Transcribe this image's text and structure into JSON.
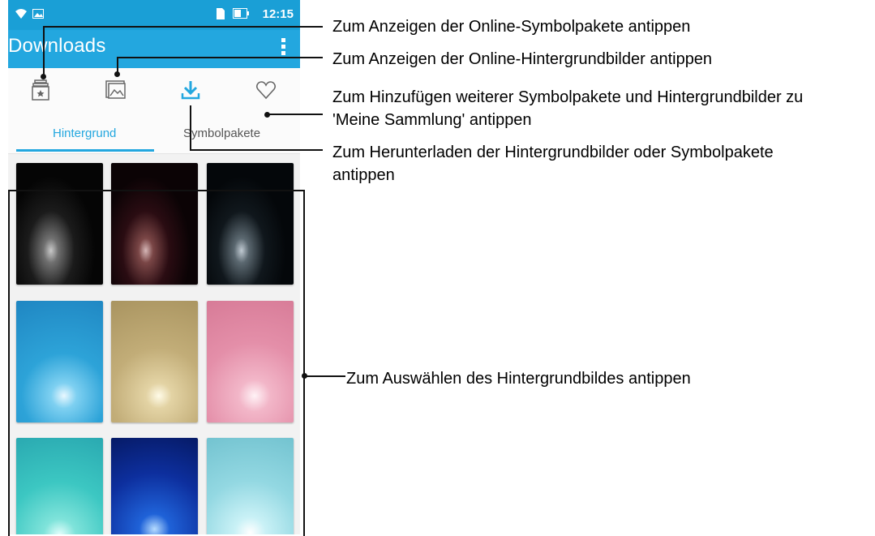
{
  "status_bar": {
    "time": "12:15"
  },
  "app_bar": {
    "title": "Downloads"
  },
  "tabs": [
    {
      "label": "Hintergrund"
    },
    {
      "label": "Symbolpakete"
    }
  ],
  "colors": {
    "accent": "#23a7df",
    "status_bar": "#1a9fd6"
  },
  "icons": [
    "symbol-pack-icon",
    "wallpaper-icon",
    "download-icon",
    "heart-icon",
    "more-vert-icon"
  ],
  "callouts": {
    "online_icon_packs": "Zum Anzeigen der Online-Symbolpakete antippen",
    "online_wallpapers": "Zum Anzeigen der Online-Hintergrundbilder antippen",
    "collection_line1": "Zum Hinzufügen weiterer Symbolpakete und Hintergrundbilder zu",
    "collection_line2": "'Meine Sammlung' antippen",
    "download_line1": "Zum Herunterladen der Hintergrundbilder oder Symbolpakete",
    "download_line2": "antippen",
    "select_wallpaper": "Zum Auswählen des Hintergrundbildes antippen"
  }
}
